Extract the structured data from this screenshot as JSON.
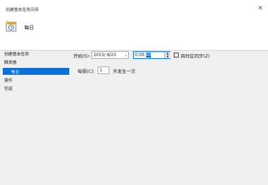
{
  "window": {
    "title": "创建基本任务向导",
    "close_glyph": "×"
  },
  "header": {
    "title": "每日",
    "icon": "calendar-clock-icon"
  },
  "nav": {
    "items": [
      {
        "label": "创建基本任务"
      },
      {
        "label": "触发器"
      },
      {
        "label": "每日"
      },
      {
        "label": "操作"
      },
      {
        "label": "完成"
      }
    ]
  },
  "form": {
    "start_label": "开始(S):",
    "date_value": "2015/ 8/23",
    "time_prefix": "0:00:",
    "time_selected": "00",
    "sync_label": "跨时区同步(Z)",
    "sync_checked": false,
    "interval_label": "每隔(C):",
    "interval_value": "1",
    "interval_suffix": "天发生一次"
  },
  "colors": {
    "accent": "#0a6fd6"
  }
}
